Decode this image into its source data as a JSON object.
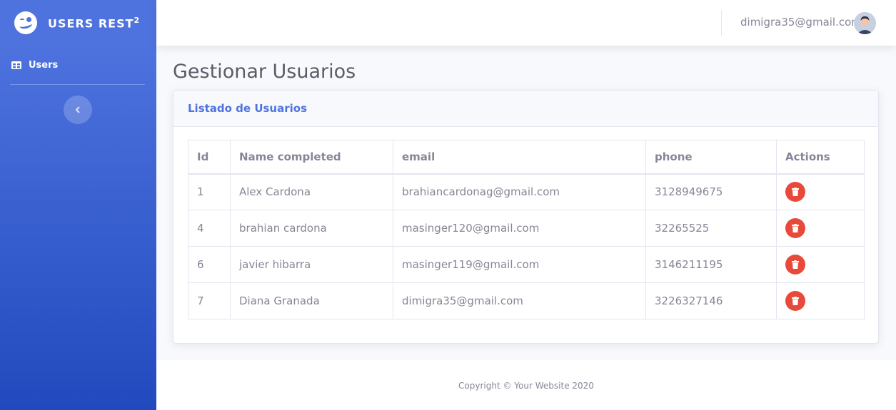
{
  "brand": {
    "title": "USERS REST",
    "superscript": "2"
  },
  "sidebar": {
    "items": [
      {
        "label": "Users",
        "icon": "table-icon"
      }
    ],
    "toggle_icon": "chevron-left-icon"
  },
  "topbar": {
    "user_email": "dimigra35@gmail.com",
    "avatar_icon": "user-avatar"
  },
  "page": {
    "title": "Gestionar Usuarios"
  },
  "card": {
    "title": "Listado de Usuarios"
  },
  "table": {
    "headers": [
      "Id",
      "Name completed",
      "email",
      "phone",
      "Actions"
    ],
    "rows": [
      {
        "id": "1",
        "name": "Alex Cardona",
        "email": "brahiancardonag@gmail.com",
        "phone": "3128949675"
      },
      {
        "id": "4",
        "name": "brahian cardona",
        "email": "masinger120@gmail.com",
        "phone": "32265525"
      },
      {
        "id": "6",
        "name": "javier hibarra",
        "email": "masinger119@gmail.com",
        "phone": "3146211195"
      },
      {
        "id": "7",
        "name": "Diana Granada",
        "email": "dimigra35@gmail.com",
        "phone": "3226327146"
      }
    ],
    "action_icon": "trash-icon"
  },
  "footer": {
    "text": "Copyright © Your Website 2020"
  },
  "colors": {
    "primary": "#4e73df",
    "danger": "#e74a3b"
  }
}
